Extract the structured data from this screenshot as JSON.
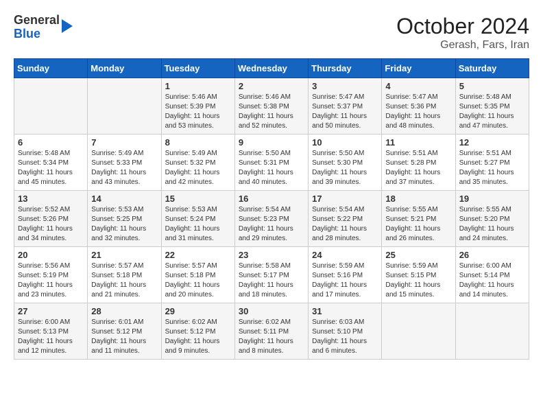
{
  "logo": {
    "general": "General",
    "blue": "Blue"
  },
  "title": "October 2024",
  "subtitle": "Gerash, Fars, Iran",
  "days_of_week": [
    "Sunday",
    "Monday",
    "Tuesday",
    "Wednesday",
    "Thursday",
    "Friday",
    "Saturday"
  ],
  "weeks": [
    [
      {
        "day": "",
        "info": ""
      },
      {
        "day": "",
        "info": ""
      },
      {
        "day": "1",
        "info": "Sunrise: 5:46 AM\nSunset: 5:39 PM\nDaylight: 11 hours and 53 minutes."
      },
      {
        "day": "2",
        "info": "Sunrise: 5:46 AM\nSunset: 5:38 PM\nDaylight: 11 hours and 52 minutes."
      },
      {
        "day": "3",
        "info": "Sunrise: 5:47 AM\nSunset: 5:37 PM\nDaylight: 11 hours and 50 minutes."
      },
      {
        "day": "4",
        "info": "Sunrise: 5:47 AM\nSunset: 5:36 PM\nDaylight: 11 hours and 48 minutes."
      },
      {
        "day": "5",
        "info": "Sunrise: 5:48 AM\nSunset: 5:35 PM\nDaylight: 11 hours and 47 minutes."
      }
    ],
    [
      {
        "day": "6",
        "info": "Sunrise: 5:48 AM\nSunset: 5:34 PM\nDaylight: 11 hours and 45 minutes."
      },
      {
        "day": "7",
        "info": "Sunrise: 5:49 AM\nSunset: 5:33 PM\nDaylight: 11 hours and 43 minutes."
      },
      {
        "day": "8",
        "info": "Sunrise: 5:49 AM\nSunset: 5:32 PM\nDaylight: 11 hours and 42 minutes."
      },
      {
        "day": "9",
        "info": "Sunrise: 5:50 AM\nSunset: 5:31 PM\nDaylight: 11 hours and 40 minutes."
      },
      {
        "day": "10",
        "info": "Sunrise: 5:50 AM\nSunset: 5:30 PM\nDaylight: 11 hours and 39 minutes."
      },
      {
        "day": "11",
        "info": "Sunrise: 5:51 AM\nSunset: 5:28 PM\nDaylight: 11 hours and 37 minutes."
      },
      {
        "day": "12",
        "info": "Sunrise: 5:51 AM\nSunset: 5:27 PM\nDaylight: 11 hours and 35 minutes."
      }
    ],
    [
      {
        "day": "13",
        "info": "Sunrise: 5:52 AM\nSunset: 5:26 PM\nDaylight: 11 hours and 34 minutes."
      },
      {
        "day": "14",
        "info": "Sunrise: 5:53 AM\nSunset: 5:25 PM\nDaylight: 11 hours and 32 minutes."
      },
      {
        "day": "15",
        "info": "Sunrise: 5:53 AM\nSunset: 5:24 PM\nDaylight: 11 hours and 31 minutes."
      },
      {
        "day": "16",
        "info": "Sunrise: 5:54 AM\nSunset: 5:23 PM\nDaylight: 11 hours and 29 minutes."
      },
      {
        "day": "17",
        "info": "Sunrise: 5:54 AM\nSunset: 5:22 PM\nDaylight: 11 hours and 28 minutes."
      },
      {
        "day": "18",
        "info": "Sunrise: 5:55 AM\nSunset: 5:21 PM\nDaylight: 11 hours and 26 minutes."
      },
      {
        "day": "19",
        "info": "Sunrise: 5:55 AM\nSunset: 5:20 PM\nDaylight: 11 hours and 24 minutes."
      }
    ],
    [
      {
        "day": "20",
        "info": "Sunrise: 5:56 AM\nSunset: 5:19 PM\nDaylight: 11 hours and 23 minutes."
      },
      {
        "day": "21",
        "info": "Sunrise: 5:57 AM\nSunset: 5:18 PM\nDaylight: 11 hours and 21 minutes."
      },
      {
        "day": "22",
        "info": "Sunrise: 5:57 AM\nSunset: 5:18 PM\nDaylight: 11 hours and 20 minutes."
      },
      {
        "day": "23",
        "info": "Sunrise: 5:58 AM\nSunset: 5:17 PM\nDaylight: 11 hours and 18 minutes."
      },
      {
        "day": "24",
        "info": "Sunrise: 5:59 AM\nSunset: 5:16 PM\nDaylight: 11 hours and 17 minutes."
      },
      {
        "day": "25",
        "info": "Sunrise: 5:59 AM\nSunset: 5:15 PM\nDaylight: 11 hours and 15 minutes."
      },
      {
        "day": "26",
        "info": "Sunrise: 6:00 AM\nSunset: 5:14 PM\nDaylight: 11 hours and 14 minutes."
      }
    ],
    [
      {
        "day": "27",
        "info": "Sunrise: 6:00 AM\nSunset: 5:13 PM\nDaylight: 11 hours and 12 minutes."
      },
      {
        "day": "28",
        "info": "Sunrise: 6:01 AM\nSunset: 5:12 PM\nDaylight: 11 hours and 11 minutes."
      },
      {
        "day": "29",
        "info": "Sunrise: 6:02 AM\nSunset: 5:12 PM\nDaylight: 11 hours and 9 minutes."
      },
      {
        "day": "30",
        "info": "Sunrise: 6:02 AM\nSunset: 5:11 PM\nDaylight: 11 hours and 8 minutes."
      },
      {
        "day": "31",
        "info": "Sunrise: 6:03 AM\nSunset: 5:10 PM\nDaylight: 11 hours and 6 minutes."
      },
      {
        "day": "",
        "info": ""
      },
      {
        "day": "",
        "info": ""
      }
    ]
  ]
}
